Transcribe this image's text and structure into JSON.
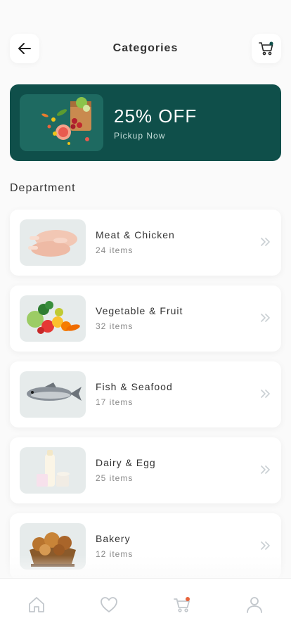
{
  "header": {
    "title": "Categories",
    "back_icon": "arrow-left-icon",
    "cart_icon": "cart-icon"
  },
  "banner": {
    "title": "25% OFF",
    "subtitle": "Pickup Now",
    "background": "#0f4f4a"
  },
  "department": {
    "title": "Department",
    "items": [
      {
        "name": "Meat & Chicken",
        "count": "24 items",
        "thumb_icon": "meat-icon"
      },
      {
        "name": "Vegetable & Fruit",
        "count": "32 items",
        "thumb_icon": "vegetable-icon"
      },
      {
        "name": "Fish & Seafood",
        "count": "17 items",
        "thumb_icon": "fish-icon"
      },
      {
        "name": "Dairy & Egg",
        "count": "25 items",
        "thumb_icon": "dairy-icon"
      },
      {
        "name": "Bakery",
        "count": "12 items",
        "thumb_icon": "bread-icon"
      }
    ]
  },
  "tabbar": {
    "items": [
      "home-icon",
      "heart-icon",
      "cart-icon",
      "profile-icon"
    ],
    "accent": "#e8643c"
  }
}
